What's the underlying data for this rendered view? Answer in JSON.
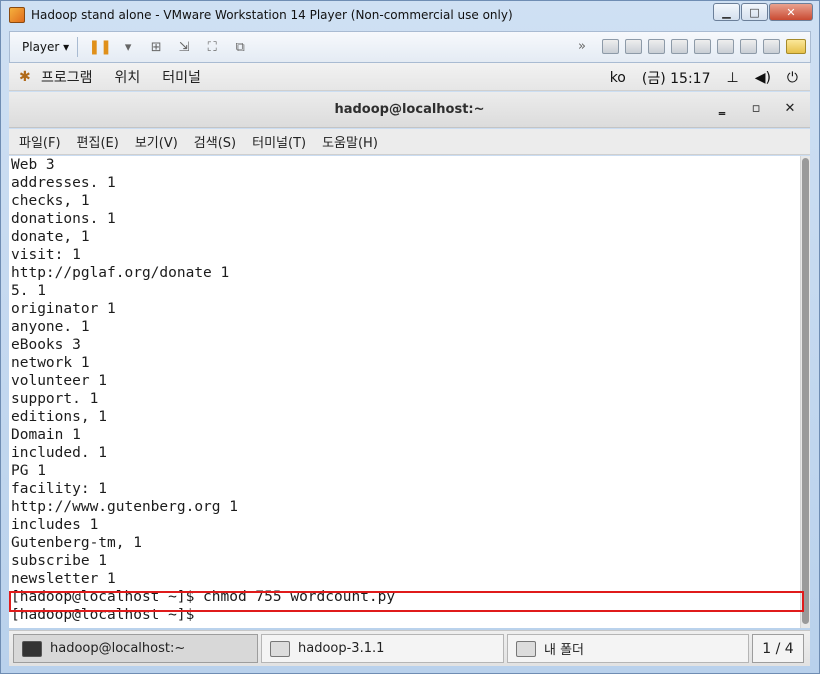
{
  "vm": {
    "title": "Hadoop stand alone - VMware Workstation 14 Player (Non-commercial use only)",
    "player_label": "Player ▾"
  },
  "gnome_panel": {
    "apps_label": "프로그램",
    "places_label": "위치",
    "terminal_label": "터미널",
    "lang": "ko",
    "clock": "(금) 15:17"
  },
  "terminal": {
    "title": "hadoop@localhost:~",
    "menu": [
      "파일(F)",
      "편집(E)",
      "보기(V)",
      "검색(S)",
      "터미널(T)",
      "도움말(H)"
    ],
    "lines": [
      "Web 3",
      "addresses. 1",
      "checks, 1",
      "donations. 1",
      "donate, 1",
      "visit: 1",
      "http://pglaf.org/donate 1",
      "5. 1",
      "originator 1",
      "anyone. 1",
      "eBooks 3",
      "network 1",
      "volunteer 1",
      "support. 1",
      "editions, 1",
      "Domain 1",
      "included. 1",
      "PG 1",
      "facility: 1",
      "http://www.gutenberg.org 1",
      "includes 1",
      "Gutenberg-tm, 1",
      "subscribe 1",
      "newsletter 1",
      "[hadoop@localhost ~]$ chmod 755 wordcount.py",
      "[hadoop@localhost ~]$ "
    ]
  },
  "taskbar": {
    "tasks": [
      "hadoop@localhost:~",
      "hadoop-3.1.1",
      "내 폴더"
    ],
    "pager": "1 / 4"
  },
  "colors": {
    "highlight": "#e01b1b"
  }
}
